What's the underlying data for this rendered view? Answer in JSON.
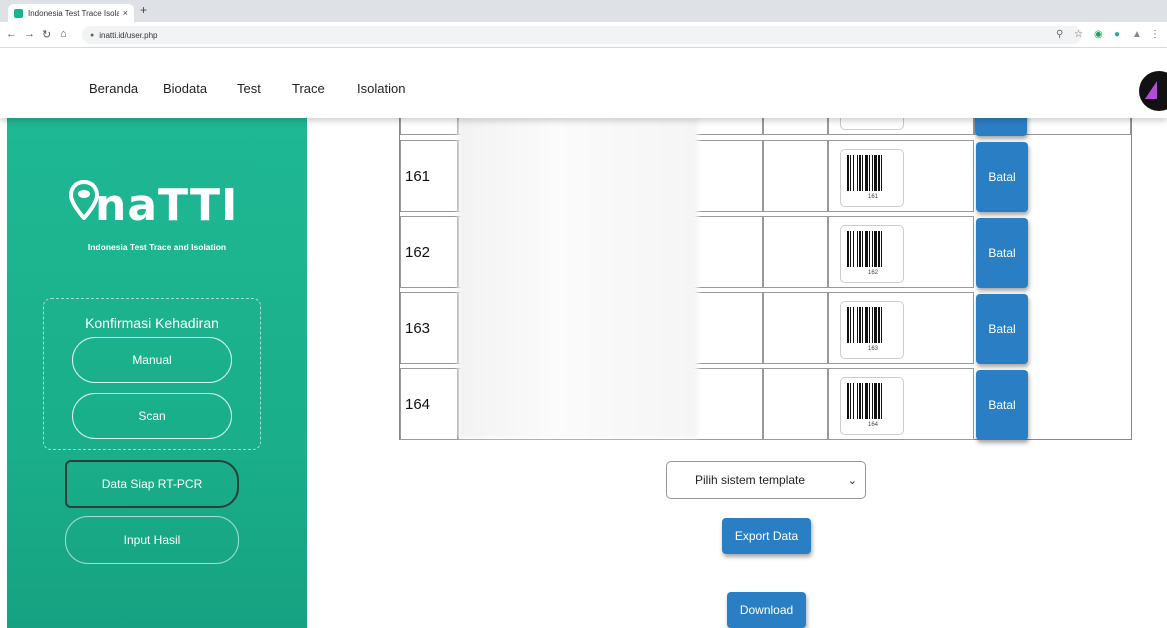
{
  "browser": {
    "tab_title": "Indonesia Test Trace Isolation",
    "tab_close": "×",
    "new_tab": "+",
    "url": "inatti.id/user.php"
  },
  "nav": {
    "links": [
      "Beranda",
      "Biodata",
      "Test",
      "Trace",
      "Isolation"
    ]
  },
  "sidebar": {
    "logo_text": "naTTI",
    "logo_subtitle": "Indonesia Test Trace and Isolation",
    "konfirmasi_title": "Konfirmasi Kehadiran",
    "manual_label": "Manual",
    "scan_label": "Scan",
    "data_siap_label": "Data Siap RT-PCR",
    "input_hasil_label": "Input Hasil"
  },
  "table": {
    "rows": [
      {
        "no": "161",
        "barcode": "161",
        "action": "Batal"
      },
      {
        "no": "162",
        "barcode": "162",
        "action": "Batal"
      },
      {
        "no": "163",
        "barcode": "163",
        "action": "Batal"
      },
      {
        "no": "164",
        "barcode": "164",
        "action": "Batal"
      }
    ]
  },
  "controls": {
    "template_select": "Pilih sistem template",
    "export_label": "Export Data",
    "download_label": "Download"
  },
  "colors": {
    "sidebar_green": "#1fb894",
    "button_blue": "#2a7fc4"
  }
}
